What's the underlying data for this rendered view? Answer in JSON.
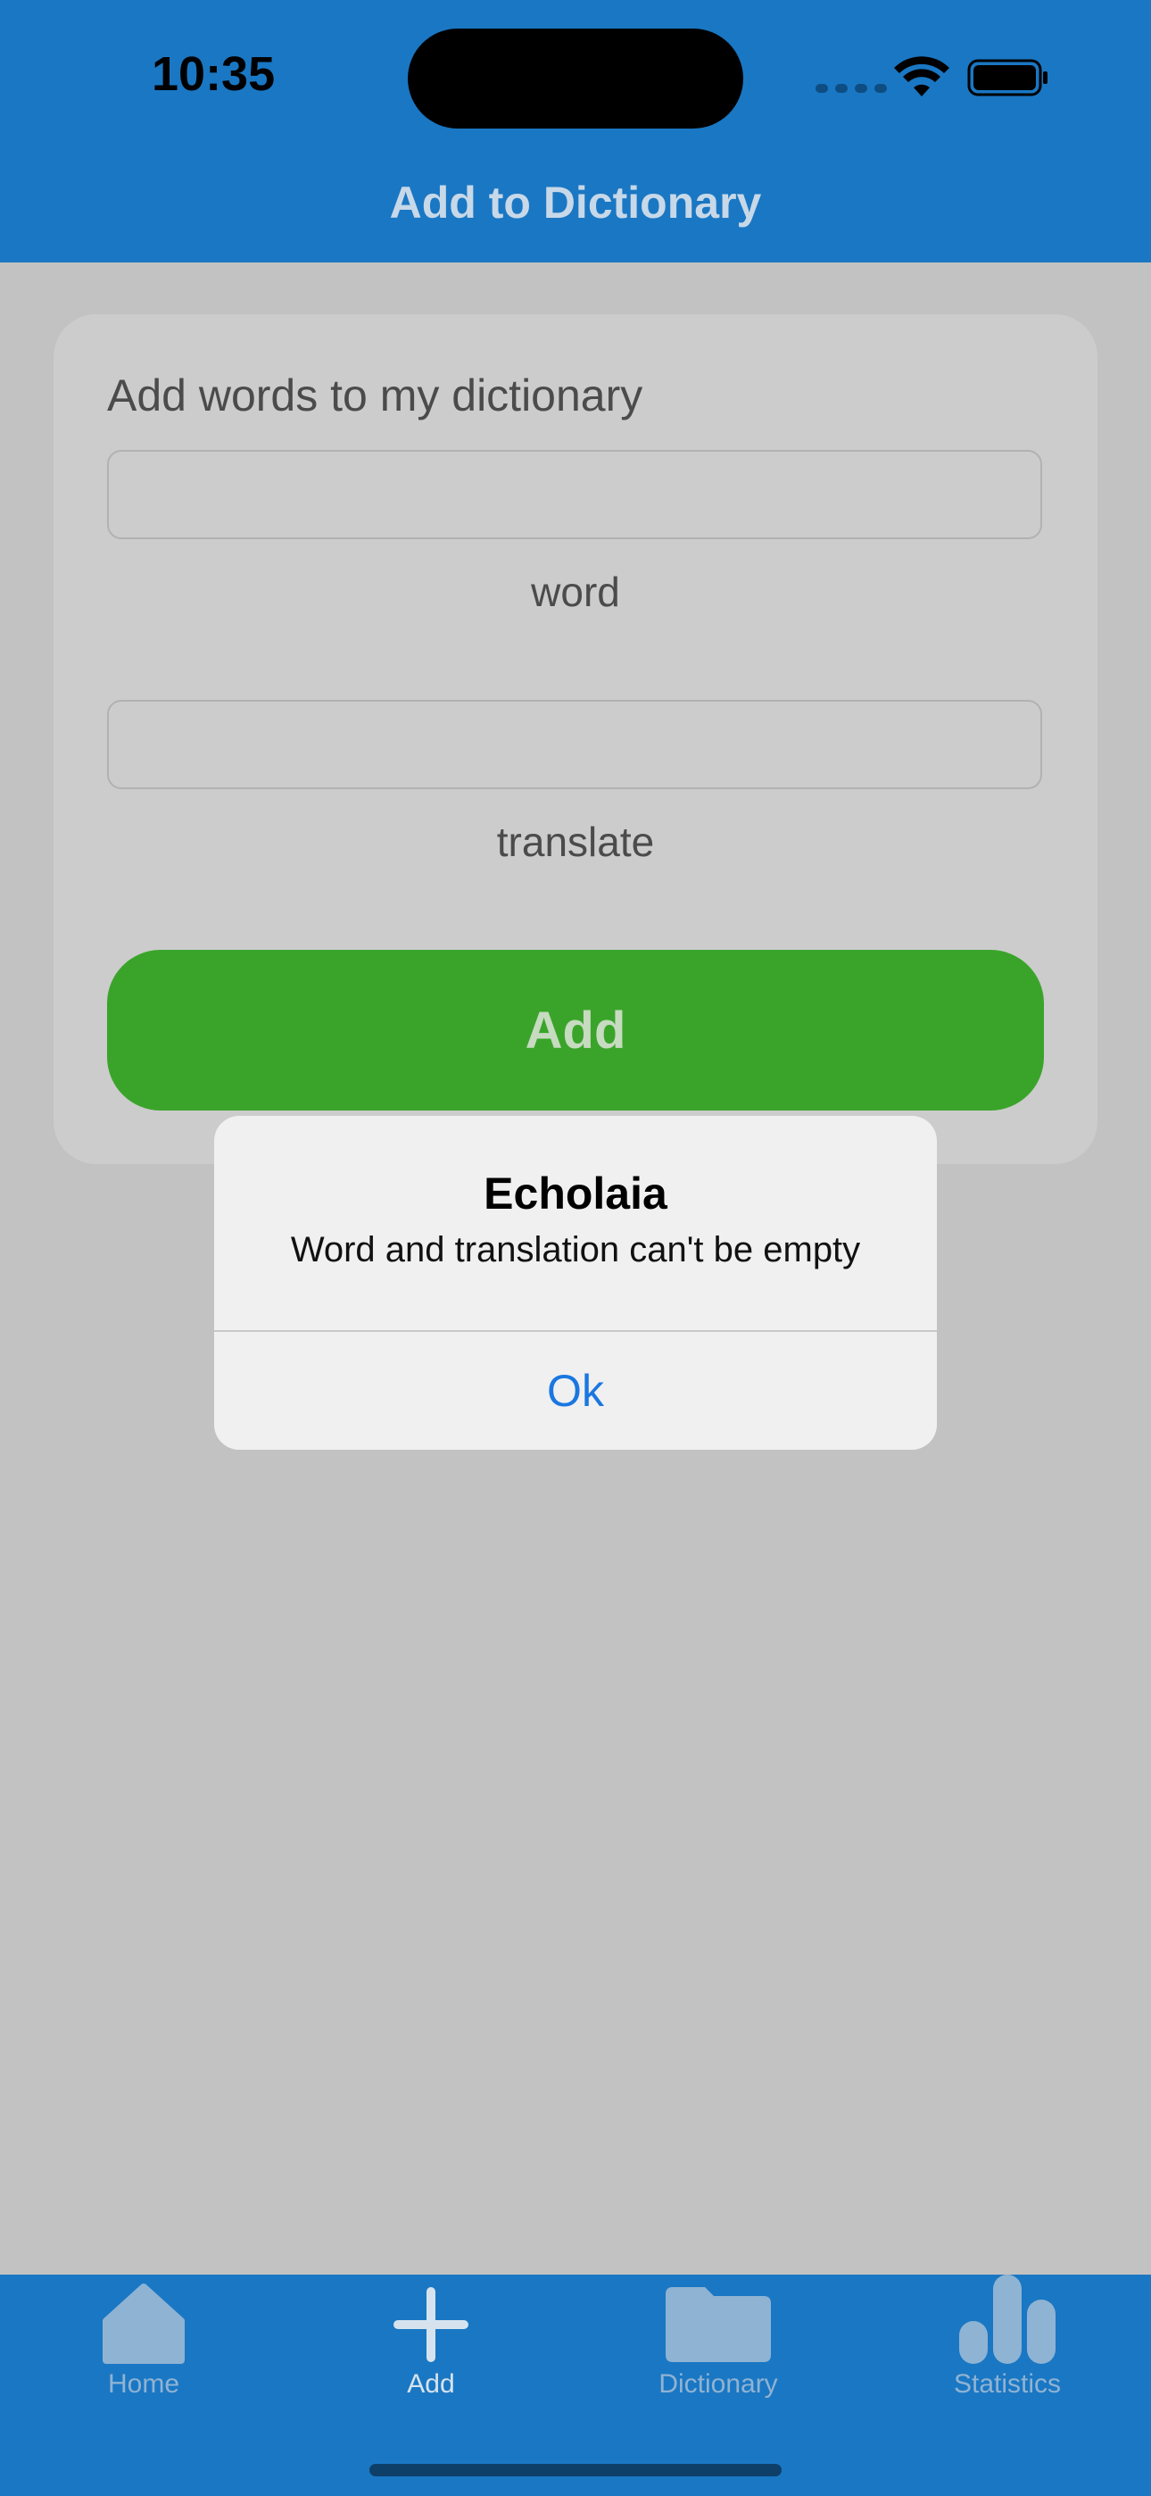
{
  "status_bar": {
    "time": "10:35"
  },
  "nav": {
    "title": "Add to Dictionary"
  },
  "form": {
    "heading": "Add words to my dictionary",
    "word_value": "",
    "word_label": "word",
    "translate_value": "",
    "translate_label": "translate",
    "add_button": "Add"
  },
  "alert": {
    "title": "Echolaia",
    "message": "Word and translation can't be empty",
    "ok_button": "Ok"
  },
  "tabs": [
    {
      "label": "Home",
      "icon": "house-icon",
      "active": false
    },
    {
      "label": "Add",
      "icon": "plus-icon",
      "active": true
    },
    {
      "label": "Dictionary",
      "icon": "folder-icon",
      "active": false
    },
    {
      "label": "Statistics",
      "icon": "bar-chart-icon",
      "active": false
    }
  ],
  "colors": {
    "accent": "#1a77c3",
    "add_button": "#3aa42a",
    "alert_action": "#1a77e0"
  }
}
